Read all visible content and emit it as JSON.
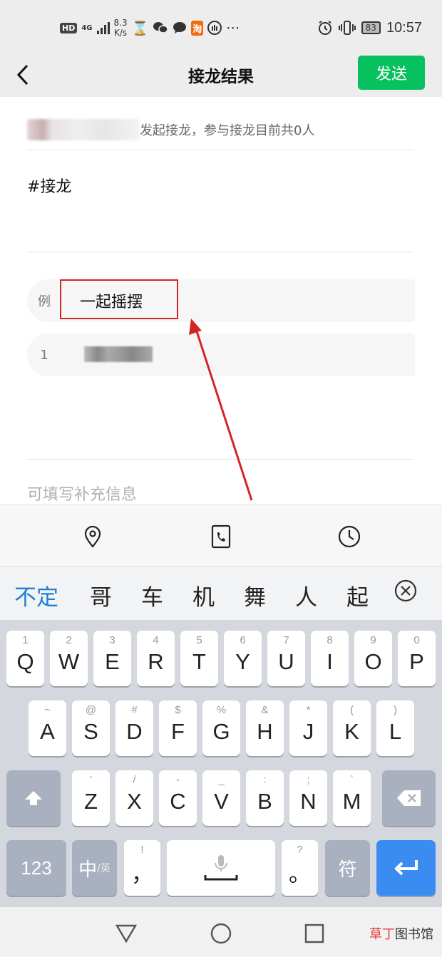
{
  "status_bar": {
    "hd": "HD",
    "network": "4G",
    "speed_value": "8.3",
    "speed_unit": "K/s",
    "taobao": "淘",
    "battery": "83",
    "time": "10:57"
  },
  "header": {
    "title": "接龙结果",
    "send_label": "发送"
  },
  "content": {
    "initiator_text": "发起接龙，参与接龙目前共0人",
    "topic": "#接龙",
    "example_label": "例",
    "example_value": "一起摇摆",
    "entry_number": "1",
    "supplement_placeholder": "可填写补充信息"
  },
  "toolbar": {
    "icons": [
      "location-icon",
      "phone-icon",
      "clock-icon"
    ]
  },
  "candidates": [
    "不定",
    "哥",
    "车",
    "机",
    "舞",
    "人",
    "起"
  ],
  "keyboard": {
    "row1": [
      {
        "hint": "1",
        "key": "Q"
      },
      {
        "hint": "2",
        "key": "W"
      },
      {
        "hint": "3",
        "key": "E"
      },
      {
        "hint": "4",
        "key": "R"
      },
      {
        "hint": "5",
        "key": "T"
      },
      {
        "hint": "6",
        "key": "Y"
      },
      {
        "hint": "7",
        "key": "U"
      },
      {
        "hint": "8",
        "key": "I"
      },
      {
        "hint": "9",
        "key": "O"
      },
      {
        "hint": "0",
        "key": "P"
      }
    ],
    "row2": [
      {
        "hint": "~",
        "key": "A"
      },
      {
        "hint": "@",
        "key": "S"
      },
      {
        "hint": "#",
        "key": "D"
      },
      {
        "hint": "$",
        "key": "F"
      },
      {
        "hint": "%",
        "key": "G"
      },
      {
        "hint": "&",
        "key": "H"
      },
      {
        "hint": "*",
        "key": "J"
      },
      {
        "hint": "(",
        "key": "K"
      },
      {
        "hint": ")",
        "key": "L"
      }
    ],
    "row3": [
      {
        "hint": "'",
        "key": "Z"
      },
      {
        "hint": "/",
        "key": "X"
      },
      {
        "hint": "-",
        "key": "C"
      },
      {
        "hint": "_",
        "key": "V"
      },
      {
        "hint": ":",
        "key": "B"
      },
      {
        "hint": ";",
        "key": "N"
      },
      {
        "hint": "`",
        "key": "M"
      }
    ],
    "num_label": "123",
    "lang_label": "中",
    "lang_sub": "/英",
    "comma_hint": "!",
    "comma": "，",
    "period_hint": "?",
    "period": "。",
    "symbol_label": "符"
  },
  "watermark": {
    "accent": "草丁",
    "rest": "图书馆"
  },
  "colors": {
    "send_green": "#07c160",
    "highlight_red": "#d42525",
    "candidate_blue": "#1f7fd6",
    "enter_blue": "#3a8cf1"
  }
}
